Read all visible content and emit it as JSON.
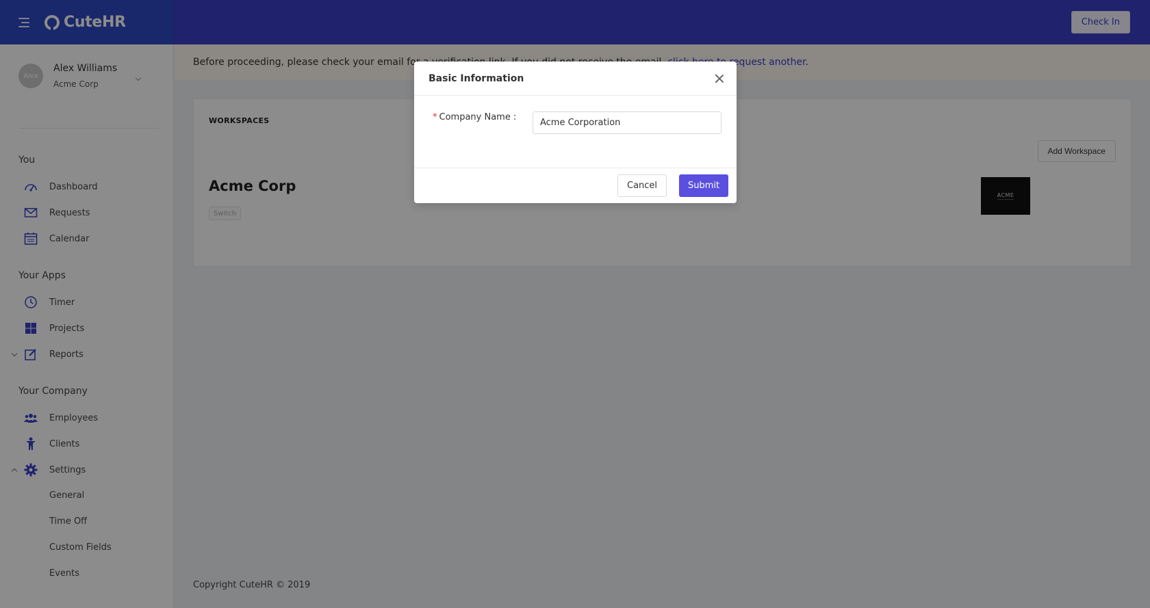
{
  "header": {
    "app_name": "CuteHR",
    "check_in_label": "Check In"
  },
  "profile": {
    "avatar_text": "Alex",
    "name": "Alex Williams",
    "company": "Acme Corp"
  },
  "sidebar": {
    "sections": {
      "you": "You",
      "apps": "Your Apps",
      "company": "Your Company"
    },
    "you_items": [
      {
        "label": "Dashboard",
        "icon": "dashboard-icon"
      },
      {
        "label": "Requests",
        "icon": "mail-icon"
      },
      {
        "label": "Calendar",
        "icon": "calendar-icon"
      }
    ],
    "app_items": [
      {
        "label": "Timer",
        "icon": "clock-icon"
      },
      {
        "label": "Projects",
        "icon": "grid-icon"
      },
      {
        "label": "Reports",
        "icon": "edit-icon"
      }
    ],
    "company_items": [
      {
        "label": "Employees",
        "icon": "team-icon"
      },
      {
        "label": "Clients",
        "icon": "person-icon"
      },
      {
        "label": "Settings",
        "icon": "gear-icon"
      }
    ],
    "settings_sub": [
      "General",
      "Time Off",
      "Custom Fields",
      "Events"
    ]
  },
  "notice": {
    "text": "Before proceeding, please check your email for a verification link. If you did not receive the email, ",
    "link": "click here to request another",
    "suffix": "."
  },
  "workspaces": {
    "title": "WORKSPACES",
    "add_label": "Add Workspace",
    "name": "Acme Corp",
    "switch_label": "Switch",
    "logo_text": "ACME"
  },
  "footer": {
    "copyright": "Copyright CuteHR © 2019"
  },
  "modal": {
    "title": "Basic Information",
    "field_label": "Company Name",
    "field_colon": ":",
    "required_mark": "*",
    "field_value": "Acme Corporation",
    "cancel_label": "Cancel",
    "submit_label": "Submit"
  },
  "colors": {
    "brand": "#3b3fc6",
    "sidebar_brand": "#2f47c3",
    "submit": "#5b4fe0"
  }
}
